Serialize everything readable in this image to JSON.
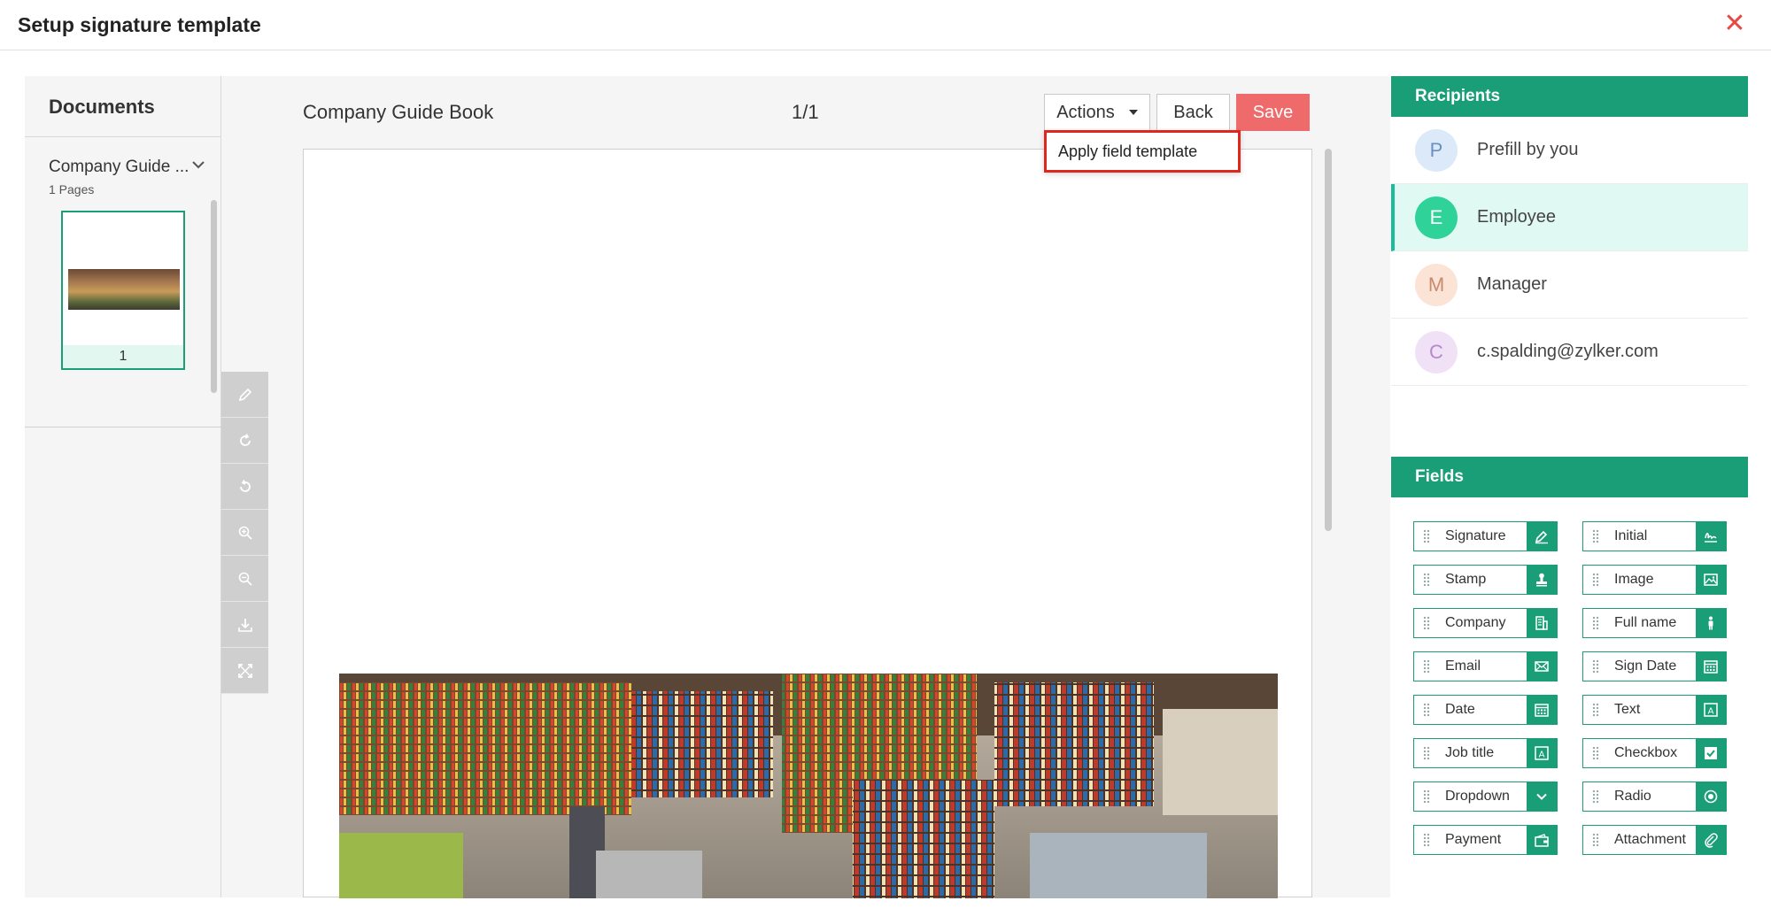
{
  "header": {
    "title": "Setup signature template"
  },
  "documents": {
    "title": "Documents",
    "items": [
      {
        "name": "Company Guide ...",
        "pages": "1 Pages",
        "thumb_page": "1"
      }
    ]
  },
  "viewer": {
    "doc_title": "Company Guide Book",
    "page_counter": "1/1",
    "actions_label": "Actions",
    "back_label": "Back",
    "save_label": "Save",
    "dropdown_item": "Apply field template"
  },
  "recipients": {
    "title": "Recipients",
    "items": [
      {
        "initial": "P",
        "name": "Prefill by you",
        "avatar_bg": "#dce9f8",
        "avatar_fg": "#6b8fc2"
      },
      {
        "initial": "E",
        "name": "Employee",
        "avatar_bg": "#2fd39a",
        "avatar_fg": "#ffffff",
        "selected": true
      },
      {
        "initial": "M",
        "name": "Manager",
        "avatar_bg": "#fbe3d6",
        "avatar_fg": "#c98a6e"
      },
      {
        "initial": "C",
        "name": "c.spalding@zylker.com",
        "avatar_bg": "#f0e1f7",
        "avatar_fg": "#b58ac8"
      }
    ]
  },
  "fields": {
    "title": "Fields",
    "items": [
      {
        "label": "Signature",
        "icon": "pen-icon"
      },
      {
        "label": "Initial",
        "icon": "initial-icon"
      },
      {
        "label": "Stamp",
        "icon": "stamp-icon"
      },
      {
        "label": "Image",
        "icon": "image-icon"
      },
      {
        "label": "Company",
        "icon": "building-icon"
      },
      {
        "label": "Full name",
        "icon": "person-icon"
      },
      {
        "label": "Email",
        "icon": "envelope-icon"
      },
      {
        "label": "Sign Date",
        "icon": "calendar-icon"
      },
      {
        "label": "Date",
        "icon": "calendar-icon"
      },
      {
        "label": "Text",
        "icon": "text-icon"
      },
      {
        "label": "Job title",
        "icon": "text-icon"
      },
      {
        "label": "Checkbox",
        "icon": "checkbox-icon"
      },
      {
        "label": "Dropdown",
        "icon": "chevron-down-icon"
      },
      {
        "label": "Radio",
        "icon": "radio-icon"
      },
      {
        "label": "Payment",
        "icon": "wallet-icon"
      },
      {
        "label": "Attachment",
        "icon": "paperclip-icon"
      }
    ]
  },
  "tools": [
    "edit-icon",
    "rotate-right-icon",
    "rotate-left-icon",
    "zoom-in-icon",
    "zoom-out-icon",
    "download-icon",
    "fullscreen-icon"
  ],
  "colors": {
    "accent": "#1a9e78",
    "save": "#ef6b6b",
    "close": "#e8483f",
    "highlight": "#e0271f"
  }
}
